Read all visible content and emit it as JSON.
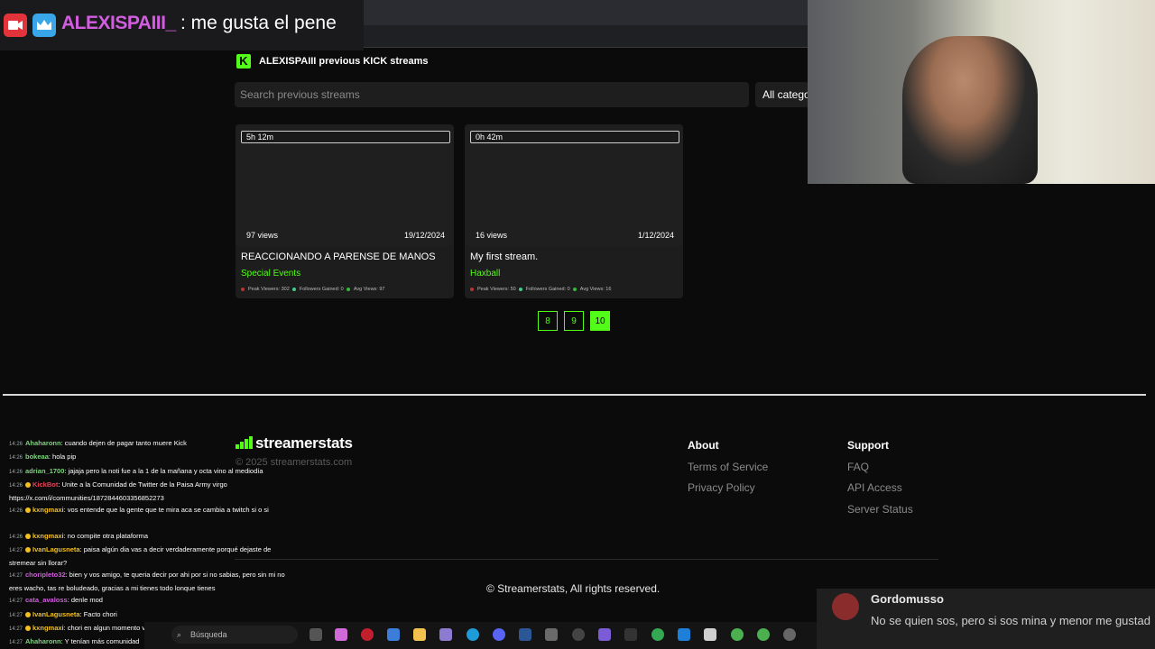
{
  "overlay": {
    "username": "ALEXISPAIII_",
    "message": ": me gusta el pene"
  },
  "header": {
    "logo_letter": "K",
    "title": "ALEXISPAIII previous KICK streams"
  },
  "search": {
    "placeholder": "Search previous streams",
    "category_label": "All categories"
  },
  "streams": [
    {
      "duration": "5h 12m",
      "views": "97 views",
      "date": "19/12/2024",
      "title": "REACCIONANDO A PARENSE DE MANOS",
      "category": "Special Events",
      "peak": "Peak Viewers: 302",
      "followers": "Followers Gained: 0",
      "avg": "Avg Views: 97"
    },
    {
      "duration": "0h 42m",
      "views": "16 views",
      "date": "1/12/2024",
      "title": "My first stream.",
      "category": "Haxball",
      "peak": "Peak Viewers: 50",
      "followers": "Followers Gained: 0",
      "avg": "Avg Views: 16"
    }
  ],
  "pagination": {
    "pages": [
      "8",
      "9",
      "10"
    ],
    "active": "10"
  },
  "footer": {
    "brand": "streamerstats",
    "copyright_small": "© 2025 streamerstats.com",
    "about_heading": "About",
    "about_links": [
      "Terms of Service",
      "Privacy Policy"
    ],
    "support_heading": "Support",
    "support_links": [
      "FAQ",
      "API Access",
      "Server Status"
    ],
    "rights": "© Streamerstats, All rights reserved."
  },
  "chat": [
    {
      "time": "14:26",
      "user": "Ahaharonn",
      "color": "#7fd37f",
      "text": ": cuando dejen de pagar tanto muere Kick"
    },
    {
      "time": "14:26",
      "user": "bokeaa",
      "color": "#7fd37f",
      "text": ": hola pip"
    },
    {
      "time": "14:26",
      "user": "adrian_1700",
      "color": "#7fd37f",
      "text": ": jajaja pero la noti fue a la 1 de la mañana y octa vino al mediodía"
    },
    {
      "time": "14:26",
      "user": "KickBot",
      "color": "#e0445a",
      "text": ": Unite a la Comunidad de Twitter de la Paisa Army virgo https://x.com/i/communities/1872844603356852273"
    },
    {
      "time": "14:26",
      "user": "kxngmaxi",
      "color": "#f3c020",
      "text": ": vos entende que la gente que te mira aca se cambia a twitch si o si"
    },
    {
      "time": "14:26",
      "user": "kxngmaxi",
      "color": "#f3c020",
      "text": ": no compite otra plataforma"
    },
    {
      "time": "14:27",
      "user": "IvanLagusneta",
      "color": "#f3c020",
      "text": ": paisa algún dia vas a decir verdaderamente porqué dejaste de stremear sin llorar?"
    },
    {
      "time": "14:27",
      "user": "choripleto32",
      "color": "#d35de0",
      "text": ": bien y vos amigo, te queria decir por ahi por si no sabias, pero sin mi no eres wacho, tas re boludeado, gracias a mi tienes todo lonque tienes"
    },
    {
      "time": "14:27",
      "user": "cata_avaloss",
      "color": "#d35de0",
      "text": ": denle mod"
    },
    {
      "time": "14:27",
      "user": "IvanLagusneta",
      "color": "#f3c020",
      "text": ": Facto chori"
    },
    {
      "time": "14:27",
      "user": "kxngmaxi",
      "color": "#f3c020",
      "text": ": chori en algun momento volves?"
    },
    {
      "time": "14:27",
      "user": "Ahaharonn",
      "color": "#7fd37f",
      "text": ": Y tenían más comunidad"
    }
  ],
  "taskbar": {
    "search_label": "Búsqueda"
  },
  "toast": {
    "name": "Gordomusso",
    "message": "No se quien sos, pero si sos mina y menor me gustad"
  },
  "colors": {
    "kick_green": "#53fc18",
    "overlay_user": "#d35de0"
  }
}
